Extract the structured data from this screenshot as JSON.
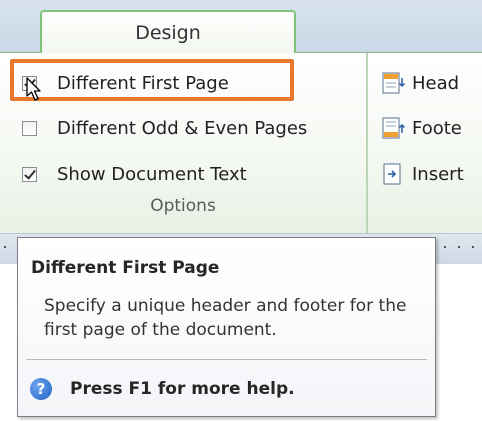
{
  "ribbon": {
    "active_tab": "Design",
    "options_group": {
      "label": "Options",
      "items": [
        {
          "label": "Different First Page",
          "checked": true
        },
        {
          "label": "Different Odd & Even Pages",
          "checked": false
        },
        {
          "label": "Show Document Text",
          "checked": true
        }
      ]
    },
    "header_footer_group": {
      "items": [
        {
          "label": "Head",
          "icon": "header-icon"
        },
        {
          "label": "Foote",
          "icon": "footer-icon"
        },
        {
          "label": "Insert",
          "icon": "insert-icon"
        }
      ]
    }
  },
  "tooltip": {
    "title": "Different First Page",
    "body": "Specify a unique header and footer for the first page of the document.",
    "help_text": "Press F1 for more help.",
    "help_icon_glyph": "?"
  },
  "colors": {
    "highlight": "#e8782c",
    "tab_border": "#7fc27a",
    "help_icon": "#1f5fc2"
  }
}
